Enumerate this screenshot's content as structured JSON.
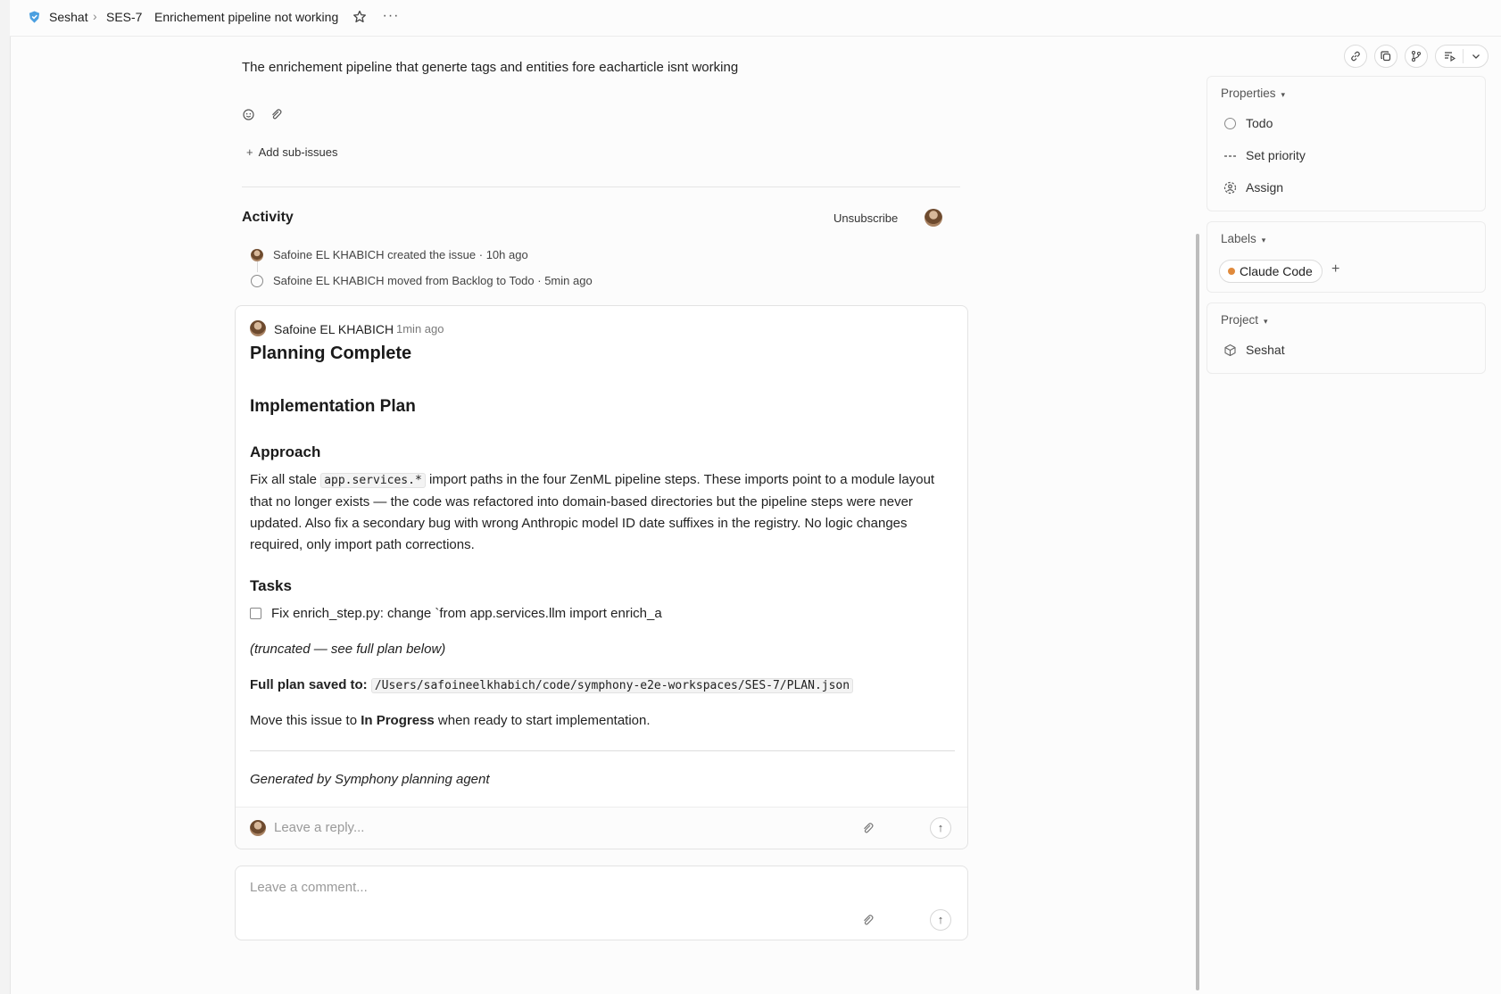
{
  "breadcrumb": {
    "team": "Seshat",
    "separator": "›",
    "issue_id": "SES-7",
    "issue_title": "Enrichement pipeline not working",
    "more": "···"
  },
  "issue": {
    "description": "The enrichement pipeline that generte tags and entities fore eacharticle isnt working",
    "add_sub_issues": "Add sub-issues",
    "add_sub_issues_icon": "+"
  },
  "activity": {
    "title": "Activity",
    "unsubscribe": "Unsubscribe",
    "events": [
      {
        "text": "Safoine EL KHABICH created the issue · 10h ago"
      },
      {
        "text": "Safoine EL KHABICH moved from Backlog to Todo · 5min ago"
      }
    ]
  },
  "comment": {
    "author": "Safoine EL KHABICH",
    "time": "1min ago",
    "heading": "Planning Complete",
    "plan_title": "Implementation Plan",
    "approach_title": "Approach",
    "approach_pre": "Fix all stale ",
    "approach_code": "app.services.*",
    "approach_post": " import paths in the four ZenML pipeline steps. These imports point to a module layout that no longer exists — the code was refactored into domain-based directories but the pipeline steps were never updated. Also fix a secondary bug with wrong Anthropic model ID date suffixes in the registry. No logic changes required, only import path corrections.",
    "tasks_title": "Tasks",
    "task_1": "Fix enrich_step.py: change `from app.services.llm import enrich_a",
    "truncated_note": "(truncated — see full plan below)",
    "saved_label": "Full plan saved to:",
    "saved_path": "/Users/safoineelkhabich/code/symphony-e2e-workspaces/SES-7/PLAN.json",
    "move_pre": "Move this issue to ",
    "move_bold": "In Progress",
    "move_post": " when ready to start implementation.",
    "generated": "Generated by Symphony planning agent",
    "reply_placeholder": "Leave a reply...",
    "send_icon": "↑"
  },
  "new_comment": {
    "placeholder": "Leave a comment...",
    "send_icon": "↑"
  },
  "sidebar": {
    "properties_title": "Properties",
    "status": "Todo",
    "priority": "Set priority",
    "assignee": "Assign",
    "labels_title": "Labels",
    "label_name": "Claude Code",
    "label_color": "#e08a3c",
    "label_add_icon": "+",
    "project_title": "Project",
    "project_name": "Seshat",
    "caret_icon": "▾"
  },
  "colors": {
    "accent": "#4a9fe0",
    "background": "#fcfcfc"
  }
}
